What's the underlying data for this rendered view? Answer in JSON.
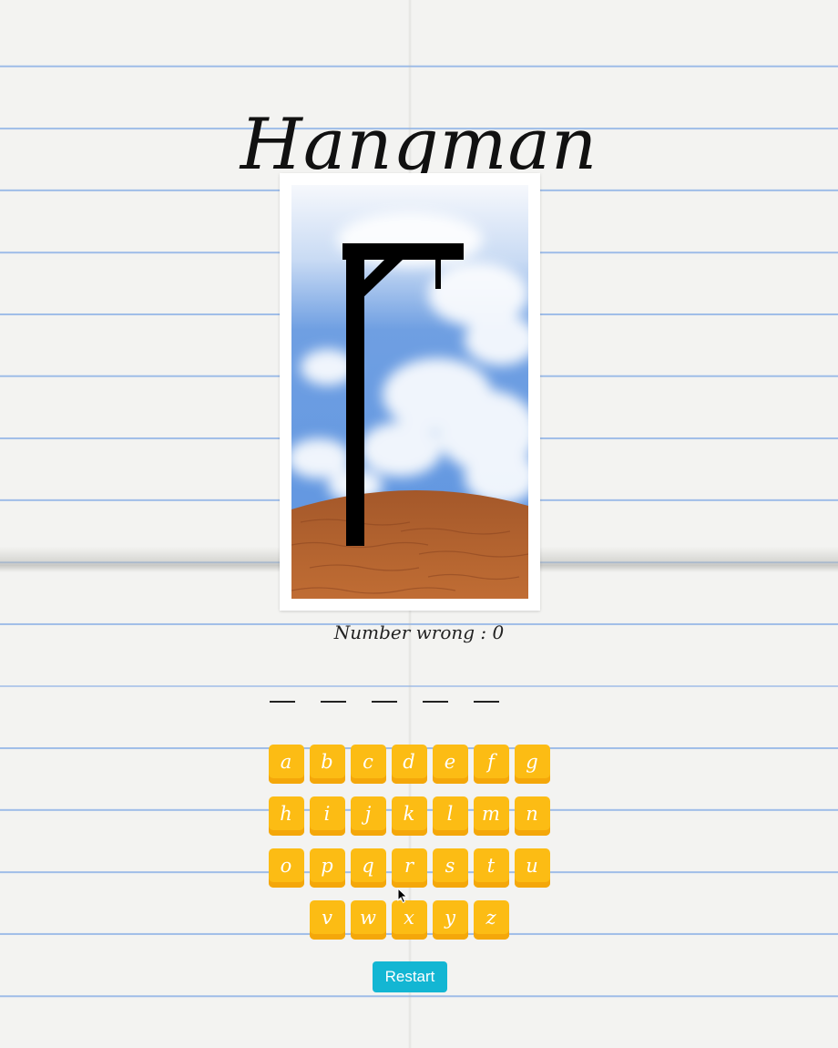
{
  "title": "Hangman",
  "status": {
    "wrong_label": "Number wrong : 0"
  },
  "word": {
    "letter_count": 5,
    "slots": [
      "",
      "",
      "",
      "",
      ""
    ]
  },
  "keyboard": {
    "rows": [
      [
        "a",
        "b",
        "c",
        "d",
        "e",
        "f",
        "g"
      ],
      [
        "h",
        "i",
        "j",
        "k",
        "l",
        "m",
        "n"
      ],
      [
        "o",
        "p",
        "q",
        "r",
        "s",
        "t",
        "u"
      ],
      [
        "v",
        "w",
        "x",
        "y",
        "z"
      ]
    ]
  },
  "restart_label": "Restart",
  "colors": {
    "key": "#fcbc14",
    "key_shadow": "#f4a70a",
    "restart": "#13b6d3",
    "sky": "#5f95e0",
    "ground": "#b0612c",
    "gallows": "#000000"
  },
  "icons": {
    "cursor": "arrow-cursor-icon"
  }
}
